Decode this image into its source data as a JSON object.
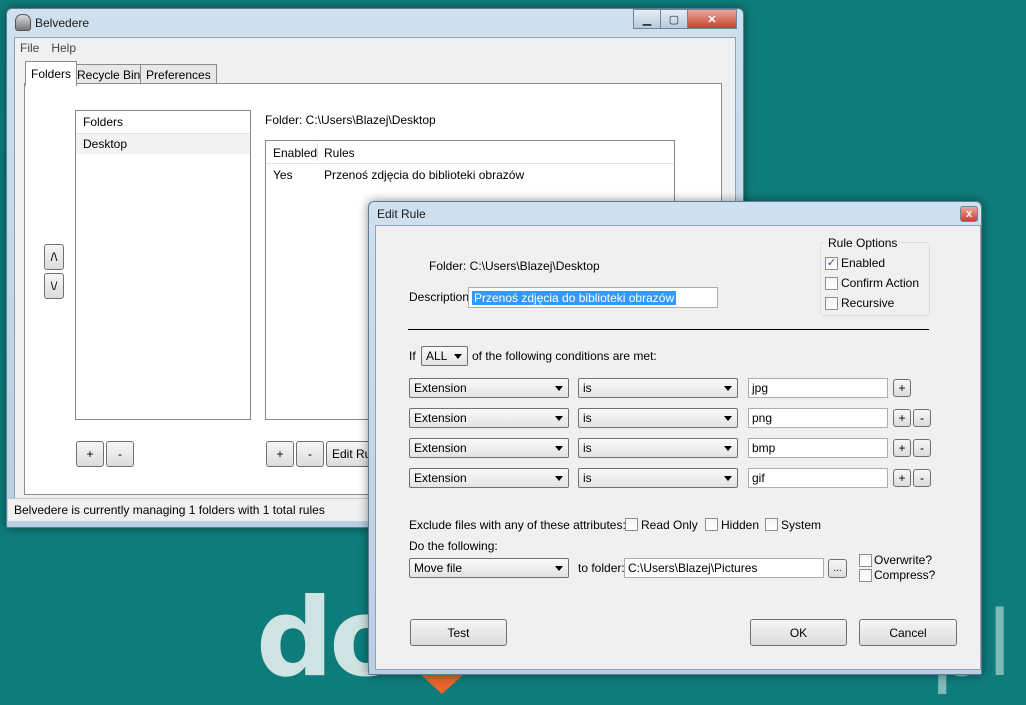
{
  "main_window": {
    "title": "Belvedere",
    "menu": [
      "File",
      "Help"
    ],
    "tabs": [
      "Folders",
      "Recycle Bin",
      "Preferences"
    ],
    "folders_header": "Folders",
    "folders": [
      "Desktop"
    ],
    "folder_label": "Folder:  C:\\Users\\Blazej\\Desktop",
    "rules_headers": [
      "Enabled",
      "Rules"
    ],
    "rules": [
      {
        "enabled": "Yes",
        "rule": "Przenoś zdjęcia do biblioteki obrazów"
      }
    ],
    "up_label": "/\\",
    "down_label": "\\/",
    "add_label": "+",
    "remove_label": "-",
    "edit_rule_label": "Edit Rule",
    "status": "Belvedere is currently managing 1 folders with 1 total rules"
  },
  "dialog": {
    "title": "Edit Rule",
    "folder_label": "Folder: C:\\Users\\Blazej\\Desktop",
    "description_label": "Description:",
    "description_value": "Przenoś zdjęcia do biblioteki obrazów",
    "rule_options_title": "Rule Options",
    "options": [
      {
        "label": "Enabled",
        "checked": true
      },
      {
        "label": "Confirm Action",
        "checked": false
      },
      {
        "label": "Recursive",
        "checked": false
      }
    ],
    "if_label": "If",
    "match_value": "ALL",
    "conditions_label": "of the following conditions are met:",
    "conditions": [
      {
        "field": "Extension",
        "op": "is",
        "value": "jpg"
      },
      {
        "field": "Extension",
        "op": "is",
        "value": "png"
      },
      {
        "field": "Extension",
        "op": "is",
        "value": "bmp"
      },
      {
        "field": "Extension",
        "op": "is",
        "value": "gif"
      }
    ],
    "exclude_label": "Exclude files with any of these attributes:",
    "attributes": [
      "Read Only",
      "Hidden",
      "System"
    ],
    "do_label": "Do the following:",
    "action_value": "Move file",
    "to_folder_label": "to folder:",
    "to_folder_value": "C:\\Users\\Blazej\\Pictures",
    "browse_label": "...",
    "overwrite_label": "Overwrite?",
    "compress_label": "Compress?",
    "test_label": "Test",
    "ok_label": "OK",
    "cancel_label": "Cancel",
    "plus_label": "+",
    "minus_label": "-",
    "close_label": "x"
  },
  "desktop": {
    "watermark_left": "do",
    "watermark_right": "pl"
  }
}
